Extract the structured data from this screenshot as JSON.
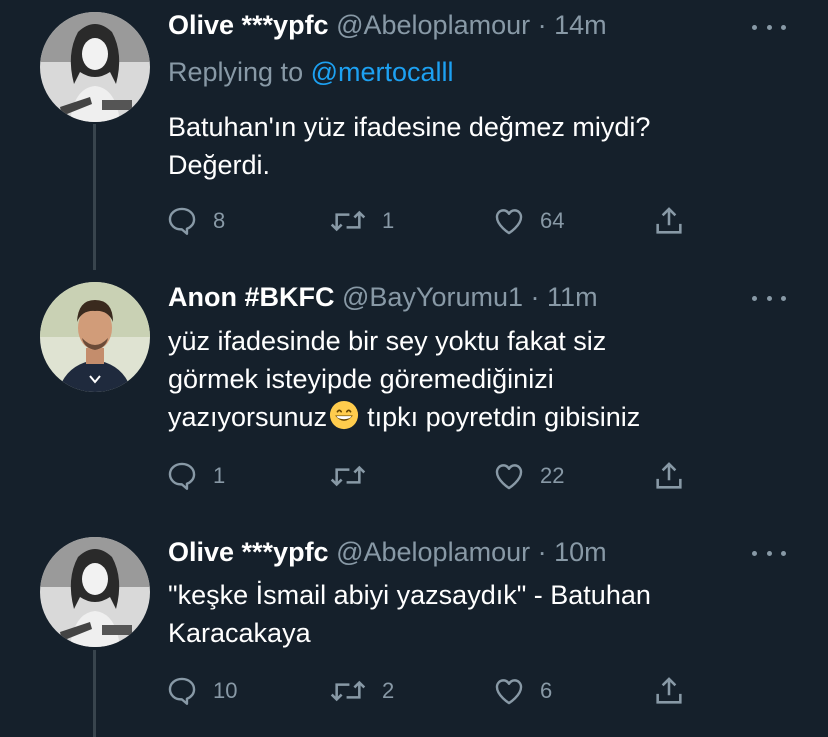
{
  "tweets": [
    {
      "name": "Olive ***ypfc",
      "handle": "@Abeloplamour",
      "dot": "·",
      "time": "14m",
      "reply_prefix": "Replying to",
      "reply_to": "@mertocalll",
      "lines": [
        "Batuhan'ın yüz ifadesine değmez miydi?",
        "Değerdi."
      ],
      "replies": "8",
      "retweets": "1",
      "likes": "64"
    },
    {
      "name": "Anon #BKFC",
      "handle": "@BayYorumu1",
      "dot": "·",
      "time": "11m",
      "lines": [
        "yüz ifadesinde bir sey yoktu fakat siz",
        "görmek isteyipde göremediğinizi"
      ],
      "line3_before": "yazıyorsunuz",
      "line3_after": "tıpkı poyretdin gibisiniz",
      "emoji": "grinning-face-icon",
      "replies": "1",
      "retweets": "",
      "likes": "22"
    },
    {
      "name": "Olive ***ypfc",
      "handle": "@Abeloplamour",
      "dot": "·",
      "time": "10m",
      "lines": [
        "\"keşke İsmail abiyi yazsaydık\" - Batuhan",
        "Karacakaya"
      ],
      "replies": "10",
      "retweets": "2",
      "likes": "6"
    }
  ],
  "colors": {
    "background": "#15202b",
    "text": "#ffffff",
    "secondary": "#8899a6",
    "link": "#1da1f2",
    "thread_line": "#38444d"
  }
}
